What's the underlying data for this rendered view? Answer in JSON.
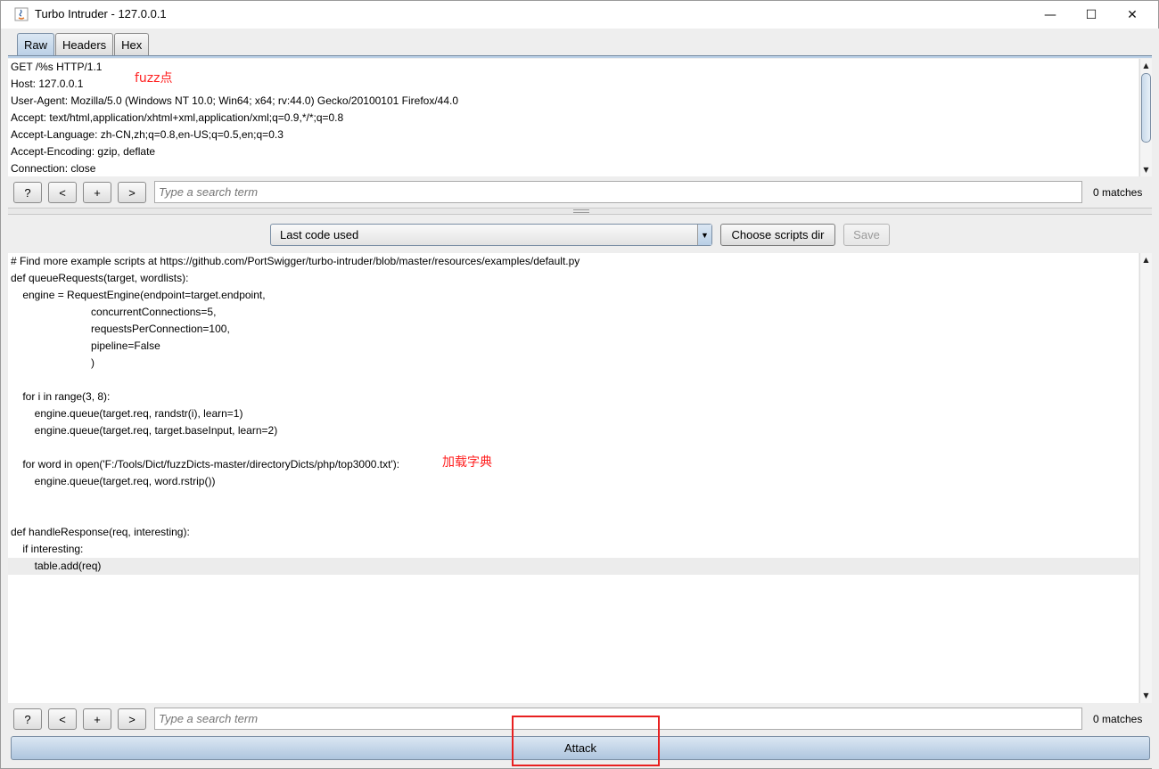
{
  "window": {
    "title": "Turbo Intruder - 127.0.0.1",
    "minimize": "—",
    "maximize": "☐",
    "close": "✕"
  },
  "tabs": [
    {
      "label": "Raw",
      "active": true
    },
    {
      "label": "Headers",
      "active": false
    },
    {
      "label": "Hex",
      "active": false
    }
  ],
  "request": {
    "lines": [
      "GET /%s HTTP/1.1",
      "Host: 127.0.0.1",
      "User-Agent: Mozilla/5.0 (Windows NT 10.0; Win64; x64; rv:44.0) Gecko/20100101 Firefox/44.0",
      "Accept: text/html,application/xhtml+xml,application/xml;q=0.9,*/*;q=0.8",
      "Accept-Language: zh-CN,zh;q=0.8,en-US;q=0.5,en;q=0.3",
      "Accept-Encoding: gzip, deflate",
      "Connection: close"
    ],
    "annotation": "fuzz点"
  },
  "search_top": {
    "help": "?",
    "prev": "<",
    "add": "+",
    "next": ">",
    "placeholder": "Type a search term",
    "matches": "0 matches"
  },
  "script_controls": {
    "selected": "Last code used",
    "choose_dir": "Choose scripts dir",
    "save": "Save"
  },
  "code": {
    "lines": [
      "# Find more example scripts at https://github.com/PortSwigger/turbo-intruder/blob/master/resources/examples/default.py",
      "def queueRequests(target, wordlists):",
      "    engine = RequestEngine(endpoint=target.endpoint,",
      "                           concurrentConnections=5,",
      "                           requestsPerConnection=100,",
      "                           pipeline=False",
      "                           )",
      "",
      "    for i in range(3, 8):",
      "        engine.queue(target.req, randstr(i), learn=1)",
      "        engine.queue(target.req, target.baseInput, learn=2)",
      "",
      "    for word in open('F:/Tools/Dict/fuzzDicts-master/directoryDicts/php/top3000.txt'):",
      "        engine.queue(target.req, word.rstrip())",
      "",
      "",
      "def handleResponse(req, interesting):",
      "    if interesting:",
      "        table.add(req)"
    ],
    "annotation": "加载字典"
  },
  "search_bottom": {
    "help": "?",
    "prev": "<",
    "add": "+",
    "next": ">",
    "placeholder": "Type a search term",
    "matches": "0 matches"
  },
  "attack_label": "Attack"
}
